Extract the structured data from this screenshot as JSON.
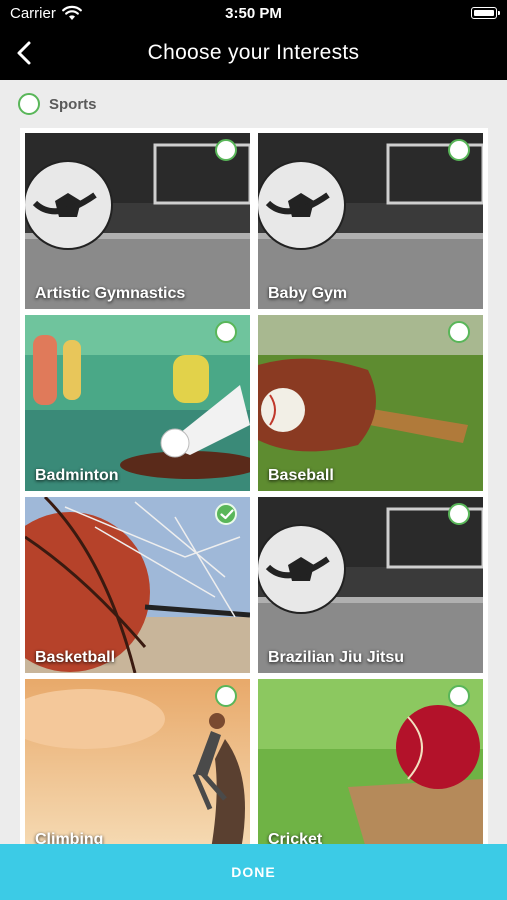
{
  "status_bar": {
    "carrier": "Carrier",
    "time": "3:50 PM"
  },
  "nav": {
    "title": "Choose your Interests",
    "back_icon": "chevron-left-icon"
  },
  "category": {
    "label": "Sports",
    "selected": false
  },
  "interests": [
    {
      "label": "Artistic Gymnastics",
      "selected": false,
      "image": "soccer-ball-photo"
    },
    {
      "label": "Baby Gym",
      "selected": false,
      "image": "soccer-ball-photo"
    },
    {
      "label": "Badminton",
      "selected": false,
      "image": "badminton-photo"
    },
    {
      "label": "Baseball",
      "selected": false,
      "image": "baseball-glove-photo"
    },
    {
      "label": "Basketball",
      "selected": true,
      "image": "basketball-net-photo"
    },
    {
      "label": "Brazilian Jiu Jitsu",
      "selected": false,
      "image": "soccer-ball-photo"
    },
    {
      "label": "Climbing",
      "selected": false,
      "image": "climber-photo"
    },
    {
      "label": "Cricket",
      "selected": false,
      "image": "cricket-ball-photo"
    }
  ],
  "footer": {
    "done_label": "DONE"
  },
  "colors": {
    "nav_bg": "#000000",
    "accent_green": "#59b659",
    "done_bg": "#3ccbe6",
    "page_bg": "#ececec"
  }
}
